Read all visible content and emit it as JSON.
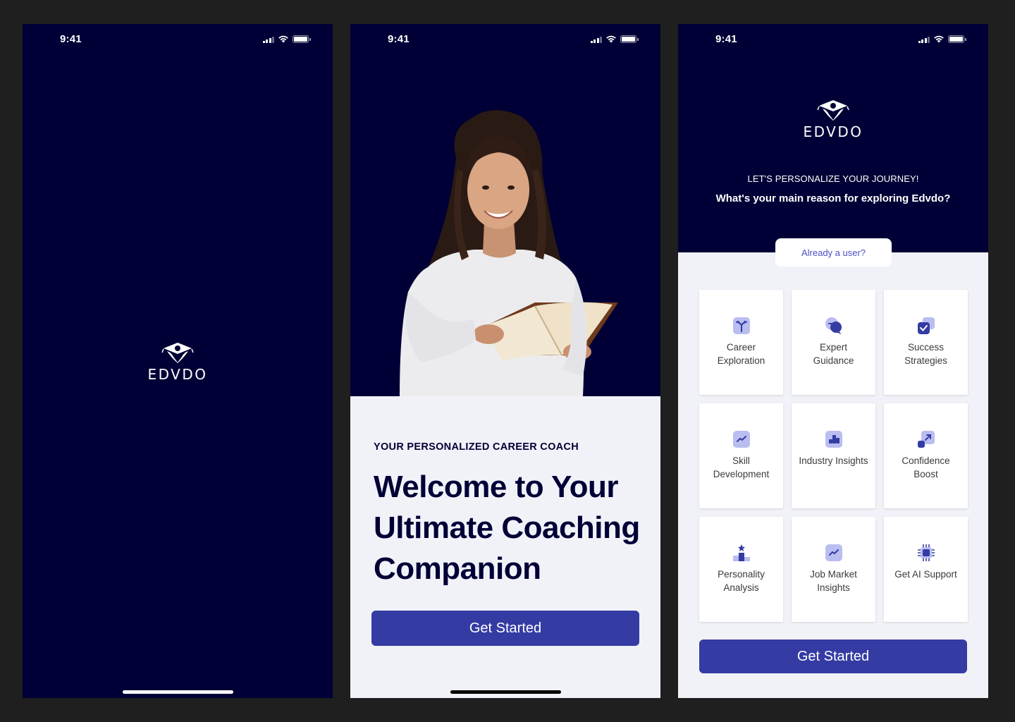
{
  "status": {
    "time": "9:41"
  },
  "brand": {
    "name": "EDVDO"
  },
  "welcome": {
    "kicker": "YOUR PERSONALIZED CAREER COACH",
    "title": "Welcome to Your Ultimate Coaching Companion",
    "cta": "Get Started"
  },
  "personalize": {
    "kicker": "LET'S PERSONALIZE YOUR JOURNEY!",
    "question": "What's your main reason for exploring Edvdo?",
    "already_user": "Already a user?",
    "options": [
      {
        "label": "Career Exploration",
        "icon": "signpost-icon"
      },
      {
        "label": "Expert Guidance",
        "icon": "chat-bubbles-icon"
      },
      {
        "label": "Success Strategies",
        "icon": "checklist-icon"
      },
      {
        "label": "Skill Development",
        "icon": "trend-chart-icon"
      },
      {
        "label": "Industry Insights",
        "icon": "blocks-chart-icon"
      },
      {
        "label": "Confidence Boost",
        "icon": "arrow-up-right-icon"
      },
      {
        "label": "Personality Analysis",
        "icon": "podium-star-icon"
      },
      {
        "label": "Job Market Insights",
        "icon": "market-trend-icon"
      },
      {
        "label": "Get AI Support",
        "icon": "ai-chip-icon"
      }
    ],
    "cta": "Get Started"
  },
  "colors": {
    "navy": "#000036",
    "accent": "#343ba3",
    "link": "#4a4fc4",
    "surface": "#f1f2f8"
  }
}
